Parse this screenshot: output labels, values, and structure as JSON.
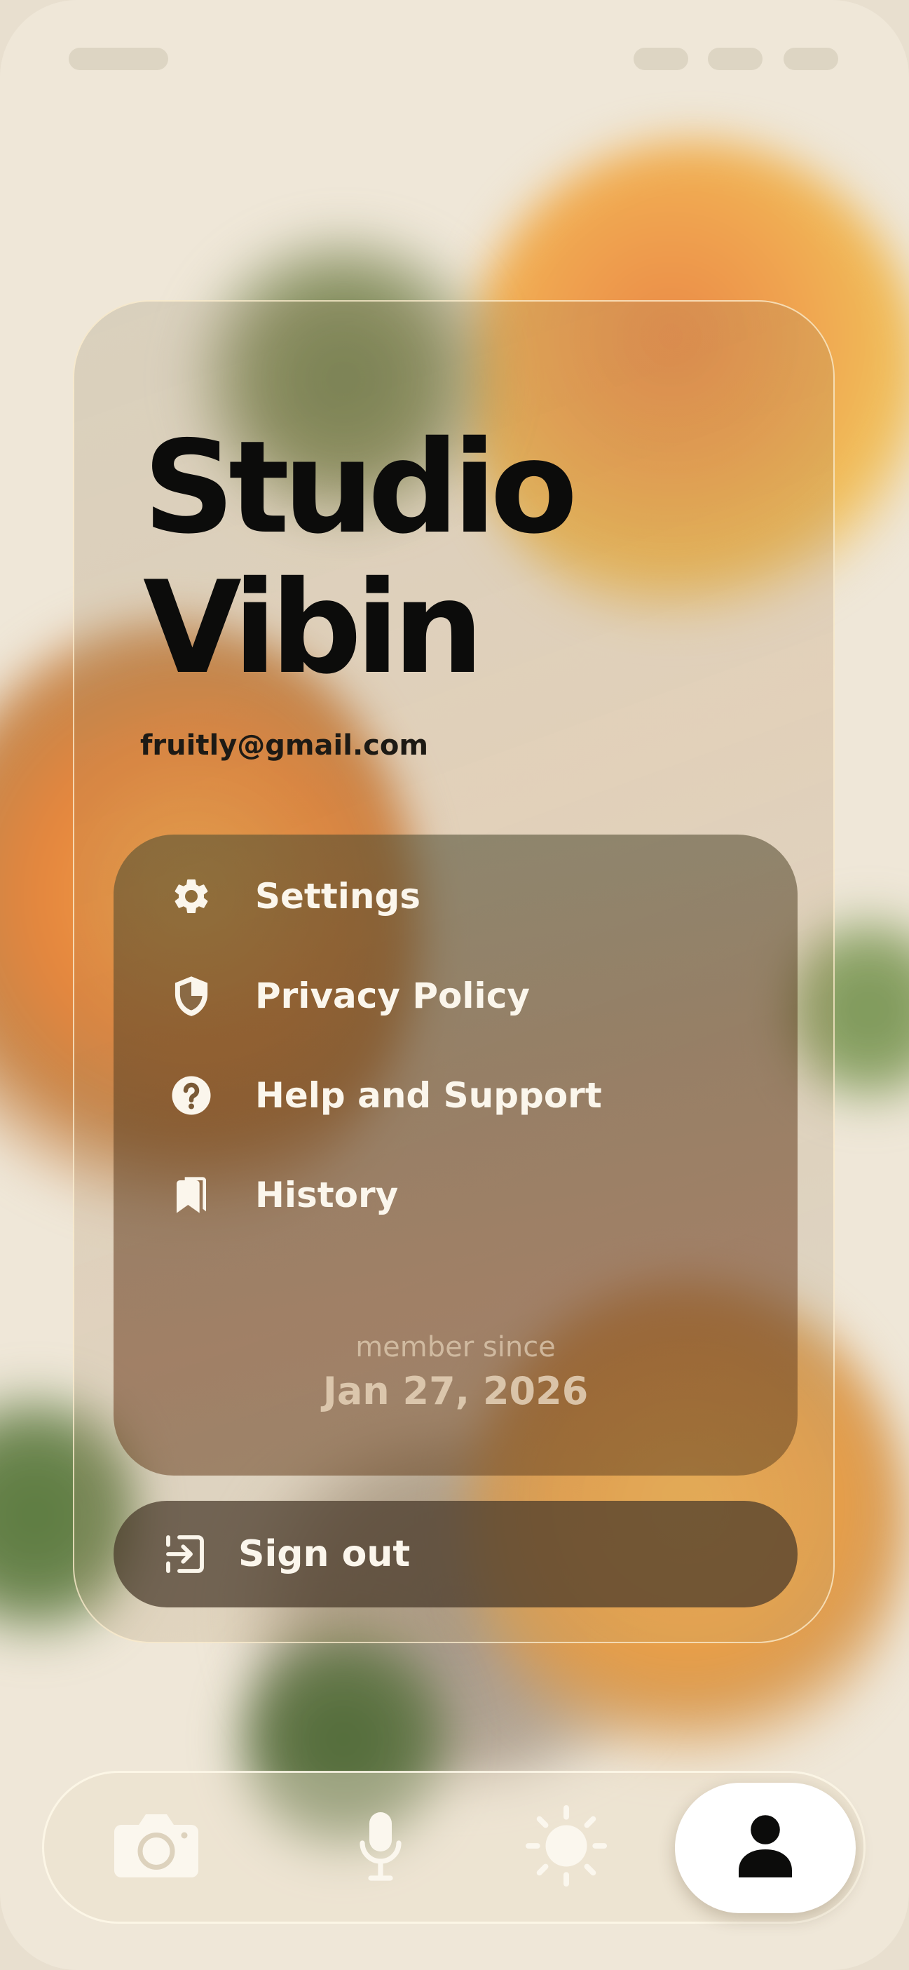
{
  "profile": {
    "name_line1": "Studio",
    "name_line2": "Vibin",
    "email": "fruitly@gmail.com"
  },
  "menu": {
    "items": [
      {
        "label": "Settings",
        "icon": "gear-icon"
      },
      {
        "label": "Privacy Policy",
        "icon": "shield-icon"
      },
      {
        "label": "Help and Support",
        "icon": "question-circle-icon"
      },
      {
        "label": "History",
        "icon": "bookmarks-icon"
      }
    ],
    "member_since_label": "member since",
    "member_since_date": "Jan 27, 2026"
  },
  "signout": {
    "label": "Sign out",
    "icon": "sign-out-icon"
  },
  "tabbar": {
    "tabs": [
      {
        "icon": "camera-icon",
        "active": false
      },
      {
        "icon": "microphone-icon",
        "active": false
      },
      {
        "icon": "sun-icon",
        "active": false
      },
      {
        "icon": "user-icon",
        "active": true
      }
    ]
  },
  "colors": {
    "title_text": "#0c0c0b",
    "menu_text": "#fbf6ec",
    "active_tab_bg": "#ffffff"
  }
}
